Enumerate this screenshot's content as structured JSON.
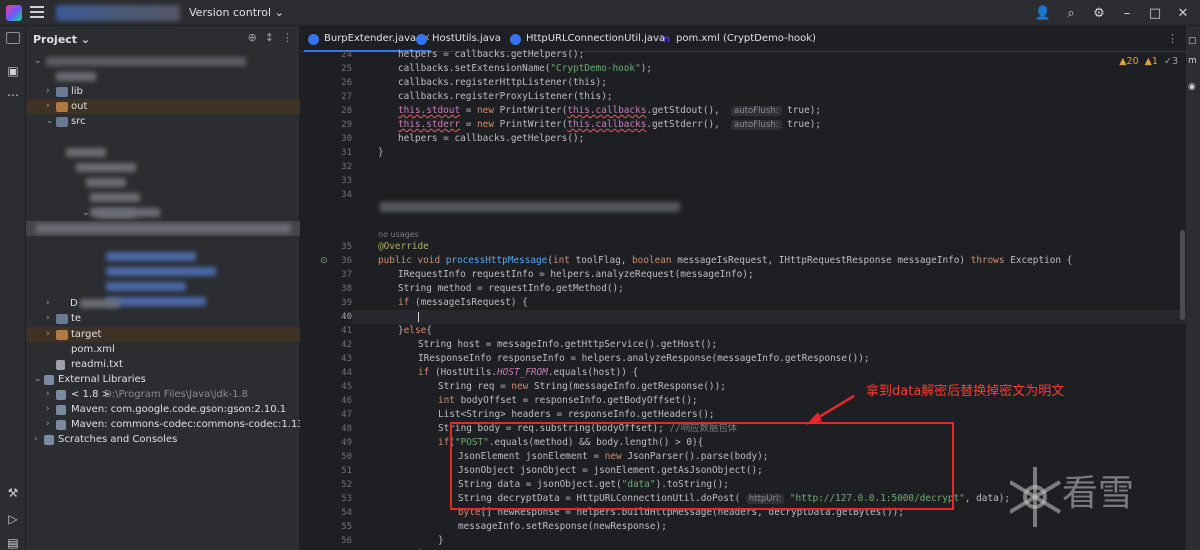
{
  "titlebar": {
    "version_control": "Version control ⌄",
    "icons": [
      "add-user-icon",
      "search-icon",
      "settings-icon",
      "minimize-icon",
      "restore-icon",
      "close-icon"
    ]
  },
  "toolstrip": {
    "icons": [
      "project-icon",
      "structure-icon",
      "more-icon",
      "build-icon",
      "run-icon",
      "terminal-icon",
      "git-icon"
    ]
  },
  "project_panel": {
    "header": "Project ⌄",
    "items": {
      "lib": "lib",
      "out": "out",
      "src": "src",
      "f1": "D",
      "f2": "te",
      "target": "target",
      "pom": "pom.xml",
      "readme": "readmi.txt",
      "ext": "External Libraries",
      "jdk": "< 1.8 >",
      "jdk_path": "D:\\Program Files\\Java\\jdk-1.8",
      "gson": "Maven: com.google.code.gson:gson:2.10.1",
      "codec": "Maven: commons-codec:commons-codec:1.13",
      "scratches": "Scratches and Consoles"
    }
  },
  "tabs": [
    {
      "label": "BurpExtender.java",
      "color": "#3574f0",
      "active": true
    },
    {
      "label": "HostUtils.java",
      "color": "#3574f0",
      "active": false
    },
    {
      "label": "HttpURLConnectionUtil.java",
      "color": "#3574f0",
      "active": false
    },
    {
      "label": "pom.xml (CryptDemo-hook)",
      "color": "#6b57ff",
      "active": false
    }
  ],
  "inspections": {
    "warnings": "▲20",
    "weak": "▲1",
    "typos": "✓3"
  },
  "line_numbers": [
    "24",
    "25",
    "26",
    "27",
    "28",
    "29",
    "30",
    "31",
    "32",
    "33",
    "34",
    "35",
    "36",
    "37",
    "38",
    "39",
    "40",
    "41",
    "42",
    "43",
    "44",
    "45",
    "46",
    "47",
    "48",
    "49",
    "50",
    "51",
    "52",
    "53",
    "54",
    "55",
    "56",
    "57",
    "58"
  ],
  "no_usages": "no usages",
  "code": {
    "l24": "helpers = callbacks.getHelpers();",
    "l25a": "callbacks.setExtensionName(",
    "l25b": "\"CryptDemo-hook\"",
    "l25c": ");",
    "l26": "callbacks.registerHttpListener(this);",
    "l27": "callbacks.registerProxyListener(this);",
    "l28a": "this.stdout",
    "l28b": " = ",
    "l28c": "new",
    "l28d": " PrintWriter(",
    "l28e": "this.callbacks",
    "l28f": ".getStdout(),  ",
    "l28g": "autoFlush:",
    "l28h": " true);",
    "l29a": "this.stderr",
    "l29b": " = ",
    "l29c": "new",
    "l29d": " PrintWriter(",
    "l29e": "this.callbacks",
    "l29f": ".getStderr(),  ",
    "l29g": "autoFlush:",
    "l29h": " true);",
    "l30": "helpers = callbacks.getHelpers();",
    "l31": "}",
    "l35": "@Override",
    "l36a": "public void ",
    "l36b": "processHttpMessage",
    "l36c": "(",
    "l36d": "int",
    "l36e": " toolFlag, ",
    "l36f": "boolean",
    "l36g": " messageIsRequest, IHttpRequestResponse messageInfo) ",
    "l36h": "throws",
    "l36i": " Exception {",
    "l37": "IRequestInfo requestInfo = helpers.analyzeRequest(messageInfo);",
    "l38": "String method = requestInfo.getMethod();",
    "l39a": "if",
    "l39b": " (messageIsRequest) {",
    "l41a": "}",
    "l41b": "else",
    "l41c": "{",
    "l42": "String host = messageInfo.getHttpService().getHost();",
    "l43": "IResponseInfo responseInfo = helpers.analyzeResponse(messageInfo.getResponse());",
    "l44a": "if",
    "l44b": " (HostUtils.",
    "l44c": "HOST_FROM",
    "l44d": ".equals(host)) {",
    "l45a": "String req = ",
    "l45b": "new",
    "l45c": " String(messageInfo.getResponse());",
    "l46a": "int",
    "l46b": " bodyOffset = responseInfo.getBodyOffset();",
    "l47": "List<String> headers = responseInfo.getHeaders();",
    "l48a": "String body = req.substring(bodyOffset); ",
    "l48b": "//响应数据包体",
    "l49a": "if",
    "l49b": "(",
    "l49c": "\"POST\"",
    "l49d": ".equals(method) && body.length() > 0){",
    "l50a": "JsonElement jsonElement = ",
    "l50b": "new",
    "l50c": " JsonParser().parse(body);",
    "l51": "JsonObject jsonObject = jsonElement.getAsJsonObject();",
    "l52a": "String data = jsonObject.get(",
    "l52b": "\"data\"",
    "l52c": ").toString();",
    "l53a": "String decryptData = HttpURLConnectionUtil.doPost( ",
    "l53b": "httpUrl:",
    "l53c": " \"http://127.0.0.1:5000/decrypt\"",
    "l53d": ", data);",
    "l54a": "byte",
    "l54b": "[] newResponse = helpers.buildHttpMessage(headers, decryptData.getBytes());",
    "l55": "messageInfo.setResponse(newResponse);",
    "l56": "}",
    "l57": "}",
    "l58": "}"
  },
  "annotation": "拿到data解密后替换掉密文为明文",
  "watermark": "看雪"
}
